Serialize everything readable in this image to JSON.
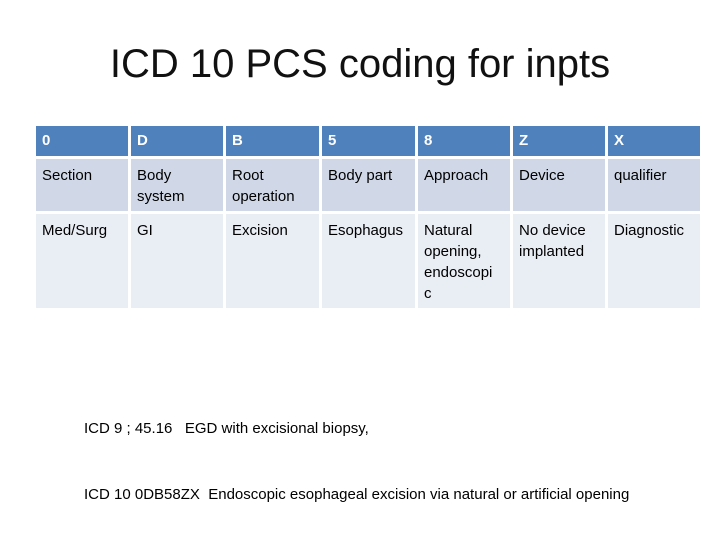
{
  "title": "ICD 10 PCS coding for inpts",
  "table": {
    "header": [
      "0",
      "D",
      "B",
      "5",
      "8",
      "Z",
      "X"
    ],
    "rows": [
      [
        "Section",
        "Body system",
        "Root operation",
        "Body part",
        "Approach",
        "Device",
        "qualifier"
      ],
      [
        "Med/Surg",
        "GI",
        "Excision",
        "Esophagus",
        "Natural opening, endoscopi c",
        "No device implanted",
        "Diagnostic"
      ]
    ]
  },
  "notes": [
    "ICD 9 ; 45.16   EGD with excisional biopsy,",
    "ICD 10 0DB58ZX  Endoscopic esophageal excision via natural or artificial opening"
  ],
  "colors": {
    "header_bg": "#4f81bd",
    "row1_bg": "#d0d8e8",
    "row2_bg": "#e9edf4"
  }
}
